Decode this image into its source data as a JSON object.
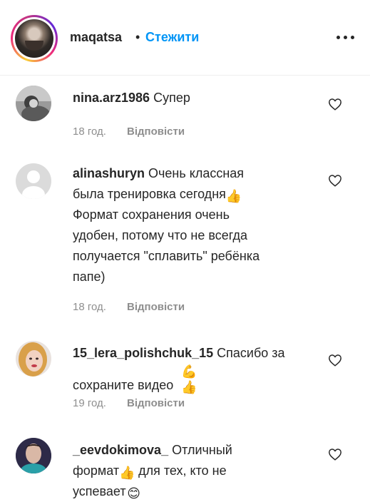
{
  "header": {
    "username": "maqatsa",
    "separator": "•",
    "follow_label": "Стежити",
    "more_icon": "more-dots-icon"
  },
  "comments": [
    {
      "username": "nina.arz1986",
      "text": "Супер",
      "time": "18 год.",
      "reply_label": "Відповісти"
    },
    {
      "username": "alinashuryn",
      "text_lines": [
        "Очень классная",
        "была тренировка сегодня",
        "Формат сохранения очень",
        "удобен, потому что не всегда",
        "получается \"сплавить\" ребёнка",
        "папе)"
      ],
      "emoji_after_line_2": "👍",
      "time": "18 год.",
      "reply_label": "Відповісти"
    },
    {
      "username": "15_lera_polishchuk_15",
      "text_line1": "Спасибо за",
      "text_line2": "сохраните видео",
      "emojis": "💪👍",
      "time": "19 год.",
      "reply_label": "Відповісти"
    },
    {
      "username": "_eevdokimova_",
      "text_line1": "Отличный",
      "text_line2a": "формат",
      "text_line2b": " для тех, кто не",
      "text_line3": "успевает",
      "emoji_thumb": "👍",
      "emoji_smile": "😊"
    }
  ],
  "colors": {
    "link_blue": "#0095f6",
    "text": "#262626",
    "muted": "#8e8e8e"
  }
}
